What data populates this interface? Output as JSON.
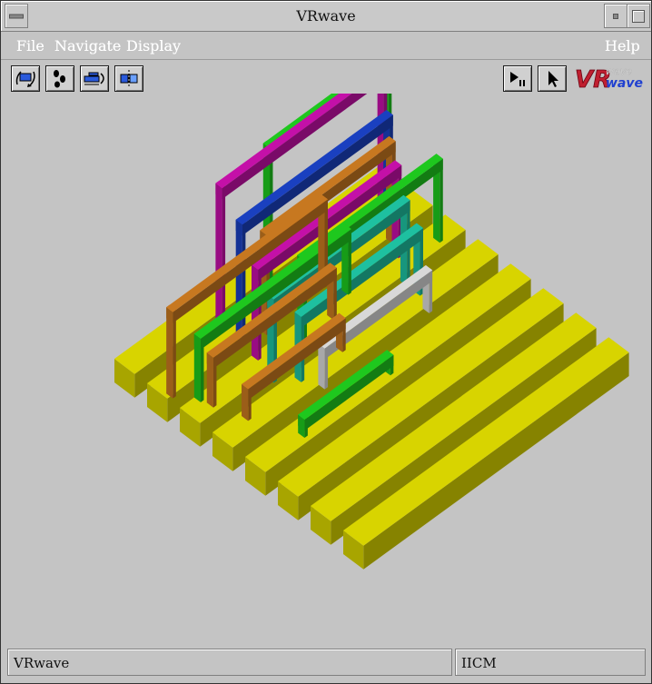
{
  "window": {
    "title": "VRwave"
  },
  "menu": {
    "items": [
      "File",
      "Navigate",
      "Display"
    ],
    "help": "Help"
  },
  "toolbar": {
    "nav_tools": [
      "flip-icon",
      "walk-icon",
      "fly-icon",
      "heads-up-icon"
    ],
    "play_pause": "play-pause-icon",
    "pointer": "pointer-icon",
    "logo": {
      "vr": "VR",
      "sub": "wave"
    }
  },
  "status": {
    "left": "VRwave",
    "right": "IICM"
  },
  "colors": {
    "yellow": "#d8d400",
    "orange": "#c77820",
    "green": "#1ec81e",
    "magenta": "#c410a8",
    "blue": "#1a40c0",
    "teal": "#1ec0a0",
    "white": "#d8d8d8"
  }
}
